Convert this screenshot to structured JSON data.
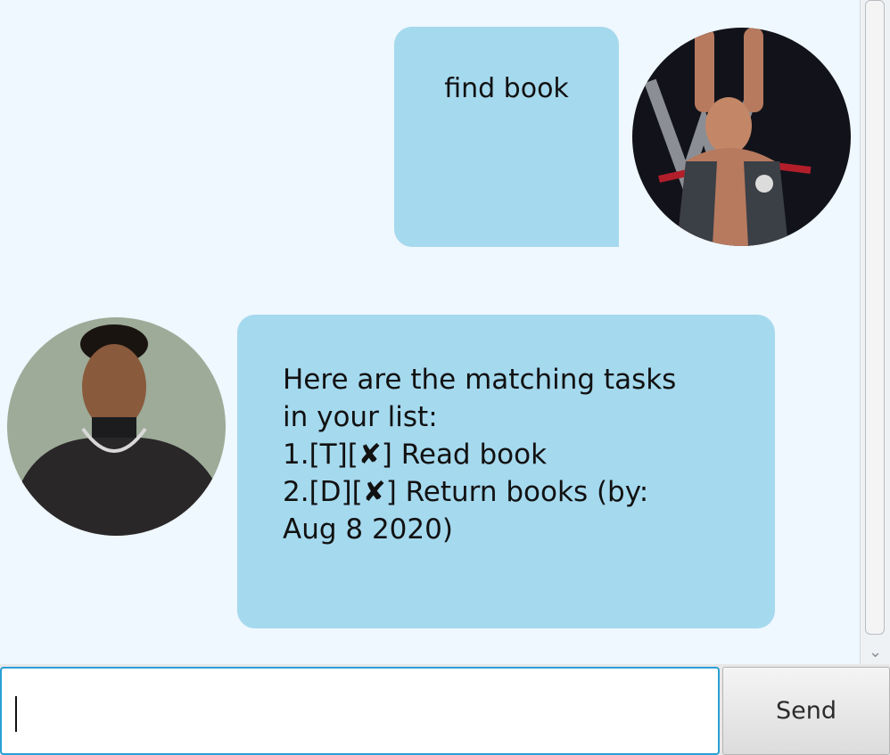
{
  "chat": {
    "messages": [
      {
        "sender": "user",
        "text": "find book"
      },
      {
        "sender": "bot",
        "lines": [
          "Here are the matching tasks",
          "in your list:",
          "1.[T][✘] Read book",
          "2.[D][✘] Return books (by:",
          "Aug 8 2020)"
        ]
      }
    ]
  },
  "input": {
    "value": "",
    "placeholder": ""
  },
  "send_button": {
    "label": "Send"
  },
  "scrollbar": {
    "down_arrow": "⌄"
  },
  "colors": {
    "background": "#eff7ff",
    "bubble": "#a5d9ee",
    "input_focus_border": "#2a9fd6"
  },
  "icons": {
    "user_avatar": "wrestler-avatar-icon",
    "bot_avatar": "man-avatar-icon"
  }
}
